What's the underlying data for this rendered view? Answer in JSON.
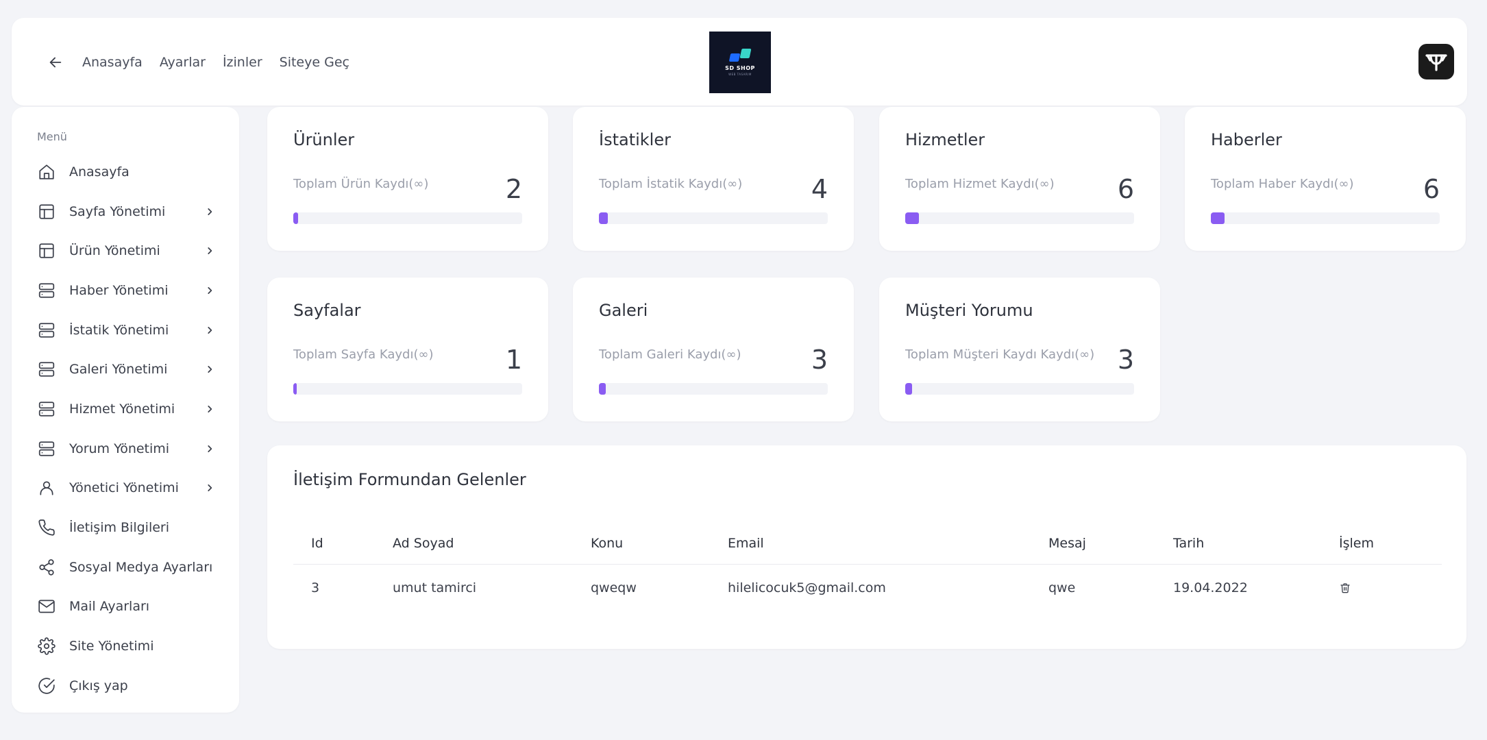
{
  "header": {
    "nav": [
      "Anasayfa",
      "Ayarlar",
      "İzinler",
      "Siteye Geç"
    ],
    "logo": {
      "name": "SD SHOP",
      "tagline": "WEB TASARIM"
    }
  },
  "sidebar": {
    "title": "Menü",
    "items": [
      {
        "label": "Anasayfa",
        "icon": "home-icon",
        "submenu": false
      },
      {
        "label": "Sayfa Yönetimi",
        "icon": "layout-icon",
        "submenu": true
      },
      {
        "label": "Ürün Yönetimi",
        "icon": "layout-icon",
        "submenu": true
      },
      {
        "label": "Haber Yönetimi",
        "icon": "server-icon",
        "submenu": true
      },
      {
        "label": "İstatik Yönetimi",
        "icon": "server-icon",
        "submenu": true
      },
      {
        "label": "Galeri Yönetimi",
        "icon": "server-icon",
        "submenu": true
      },
      {
        "label": "Hizmet Yönetimi",
        "icon": "server-icon",
        "submenu": true
      },
      {
        "label": "Yorum Yönetimi",
        "icon": "server-icon",
        "submenu": true
      },
      {
        "label": "Yönetici Yönetimi",
        "icon": "user-icon",
        "submenu": true
      },
      {
        "label": "İletişim Bilgileri",
        "icon": "phone-icon",
        "submenu": false
      },
      {
        "label": "Sosyal Medya Ayarları",
        "icon": "share-icon",
        "submenu": false
      },
      {
        "label": "Mail Ayarları",
        "icon": "mail-icon",
        "submenu": false
      },
      {
        "label": "Site Yönetimi",
        "icon": "settings-icon",
        "submenu": false
      },
      {
        "label": "Çıkış yap",
        "icon": "check-circle-icon",
        "submenu": false
      }
    ]
  },
  "stats": [
    {
      "title": "Ürünler",
      "label": "Toplam Ürün Kaydı(∞)",
      "value": "2",
      "progress": 0.02
    },
    {
      "title": "İstatikler",
      "label": "Toplam İstatik Kaydı(∞)",
      "value": "4",
      "progress": 0.04
    },
    {
      "title": "Hizmetler",
      "label": "Toplam Hizmet Kaydı(∞)",
      "value": "6",
      "progress": 0.06
    },
    {
      "title": "Haberler",
      "label": "Toplam Haber Kaydı(∞)",
      "value": "6",
      "progress": 0.06
    },
    {
      "title": "Sayfalar",
      "label": "Toplam Sayfa Kaydı(∞)",
      "value": "1",
      "progress": 0.01
    },
    {
      "title": "Galeri",
      "label": "Toplam Galeri Kaydı(∞)",
      "value": "3",
      "progress": 0.03
    },
    {
      "title": "Müşteri Yorumu",
      "label": "Toplam Müşteri Kaydı Kaydı(∞)",
      "value": "3",
      "progress": 0.03
    }
  ],
  "contact": {
    "title": "İletişim Formundan Gelenler",
    "columns": [
      "Id",
      "Ad Soyad",
      "Konu",
      "Email",
      "Mesaj",
      "Tarih",
      "İşlem"
    ],
    "rows": [
      {
        "id": "3",
        "name": "umut tamirci",
        "subject": "qweqw",
        "email": "hilelicocuk5@gmail.com",
        "message": "qwe",
        "date": "19.04.2022"
      }
    ]
  }
}
